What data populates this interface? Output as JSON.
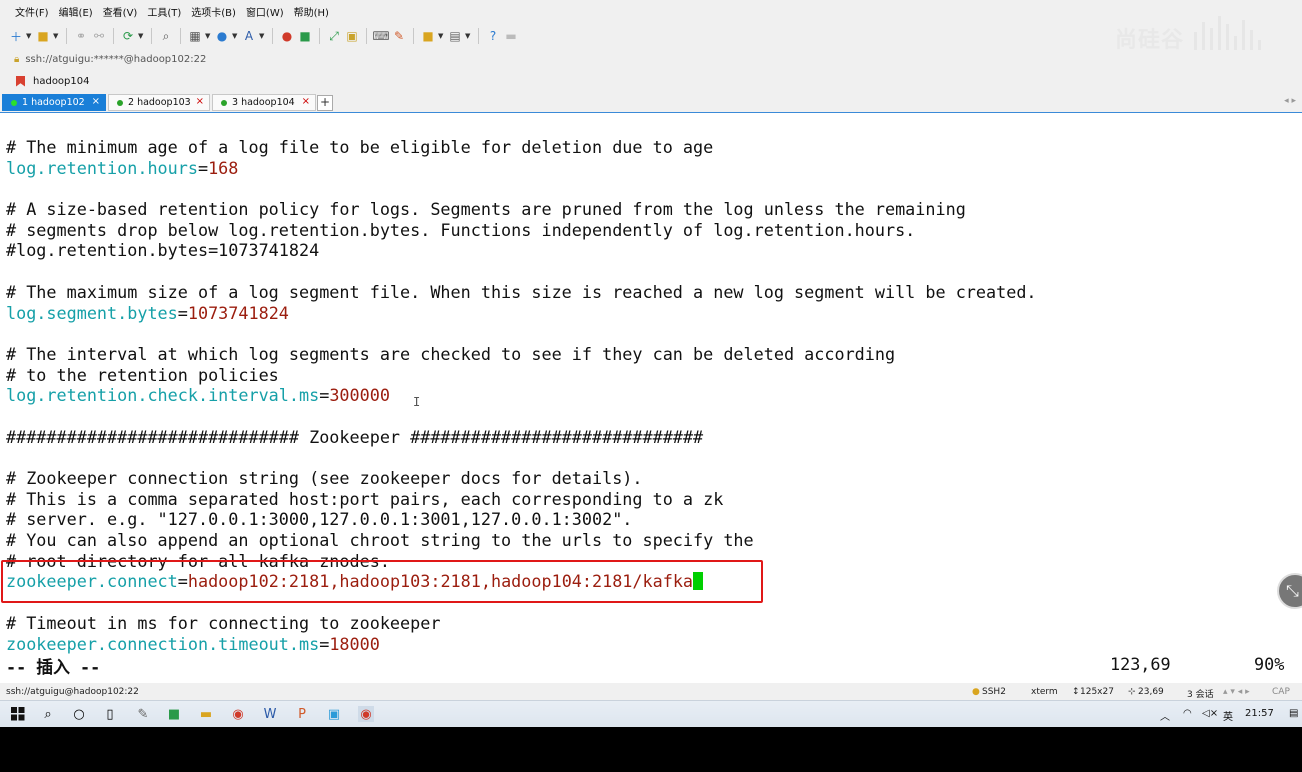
{
  "menu": [
    "文件(F)",
    "编辑(E)",
    "查看(V)",
    "工具(T)",
    "选项卡(B)",
    "窗口(W)",
    "帮助(H)"
  ],
  "brand": "尚硅谷",
  "address": "ssh://atguigu:******@hadoop102:22",
  "bookmark": "hadoop104",
  "tabs": [
    {
      "label": "1 hadoop102",
      "close": "×"
    },
    {
      "label": "2 hadoop103",
      "close": "×"
    },
    {
      "label": "3 hadoop104",
      "close": "×"
    }
  ],
  "tab_add": "+",
  "tab_nav": "◂ ▸",
  "terminal": {
    "lines": [
      [
        {
          "t": "# The minimum age of a log file to be eligible for deletion due to age",
          "c": ""
        }
      ],
      [
        {
          "t": "log.retention.hours",
          "c": "k"
        },
        {
          "t": "=",
          "c": ""
        },
        {
          "t": "168",
          "c": "v"
        }
      ],
      [
        {
          "t": "",
          "c": ""
        }
      ],
      [
        {
          "t": "# A size-based retention policy for logs. Segments are pruned from the log unless the remaining",
          "c": ""
        }
      ],
      [
        {
          "t": "# segments drop below log.retention.bytes. Functions independently of log.retention.hours.",
          "c": ""
        }
      ],
      [
        {
          "t": "#log.retention.bytes=1073741824",
          "c": ""
        }
      ],
      [
        {
          "t": "",
          "c": ""
        }
      ],
      [
        {
          "t": "# The maximum size of a log segment file. When this size is reached a new log segment will be created.",
          "c": ""
        }
      ],
      [
        {
          "t": "log.segment.bytes",
          "c": "k"
        },
        {
          "t": "=",
          "c": ""
        },
        {
          "t": "1073741824",
          "c": "v"
        }
      ],
      [
        {
          "t": "",
          "c": ""
        }
      ],
      [
        {
          "t": "# The interval at which log segments are checked to see if they can be deleted according",
          "c": ""
        }
      ],
      [
        {
          "t": "# to the retention policies",
          "c": ""
        }
      ],
      [
        {
          "t": "log.retention.check.interval.ms",
          "c": "k"
        },
        {
          "t": "=",
          "c": ""
        },
        {
          "t": "300000",
          "c": "v"
        }
      ],
      [
        {
          "t": "",
          "c": ""
        }
      ],
      [
        {
          "t": "############################# Zookeeper #############################",
          "c": ""
        }
      ],
      [
        {
          "t": "",
          "c": ""
        }
      ],
      [
        {
          "t": "# Zookeeper connection string (see zookeeper docs for details).",
          "c": ""
        }
      ],
      [
        {
          "t": "# This is a comma separated host:port pairs, each corresponding to a zk",
          "c": ""
        }
      ],
      [
        {
          "t": "# server. e.g. \"127.0.0.1:3000,127.0.0.1:3001,127.0.0.1:3002\".",
          "c": ""
        }
      ],
      [
        {
          "t": "# You can also append an optional chroot string to the urls to specify the",
          "c": ""
        }
      ],
      [
        {
          "t": "# root directory for all kafka znodes.",
          "c": ""
        }
      ],
      [
        {
          "t": "zookeeper.connect",
          "c": "k"
        },
        {
          "t": "=",
          "c": ""
        },
        {
          "t": "hadoop102:2181,hadoop103:2181,hadoop104:2181/kafka",
          "c": "v"
        },
        {
          "t": "",
          "c": "cursor"
        }
      ],
      [
        {
          "t": "",
          "c": ""
        }
      ],
      [
        {
          "t": "# Timeout in ms for connecting to zookeeper",
          "c": ""
        }
      ],
      [
        {
          "t": "zookeeper.connection.timeout.ms",
          "c": "k"
        },
        {
          "t": "=",
          "c": ""
        },
        {
          "t": "18000",
          "c": "v"
        }
      ]
    ],
    "mode": "-- 插入 --",
    "position": "123,69",
    "percent": "90%"
  },
  "session_bar": {
    "path": "ssh://atguigu@hadoop102:22",
    "protocol": "SSH2",
    "terminal": "xterm",
    "size": "125x27",
    "cursor": "23,69",
    "sessions": "3 会话",
    "caps": "CAP"
  },
  "taskbar": {
    "ime_mode": "英",
    "time": "21:57"
  },
  "colors": {
    "key": "#16a0a8",
    "value": "#9b1d0e",
    "cursor": "#00d000",
    "highlight": "#e01818",
    "active_tab": "#1a7fd8"
  }
}
